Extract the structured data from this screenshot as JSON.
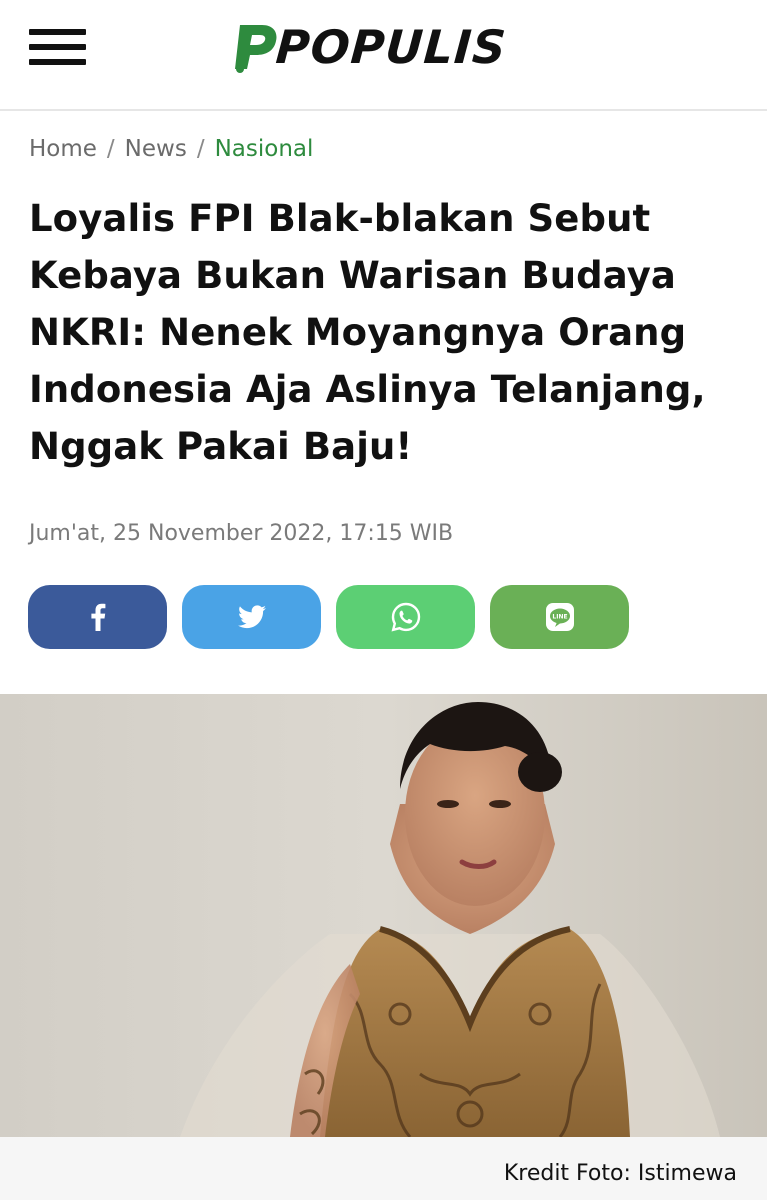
{
  "header": {
    "logo_text": "POPULIS",
    "logo_color": "#2e8b3e"
  },
  "breadcrumb": {
    "items": [
      "Home",
      "News",
      "Nasional"
    ],
    "separator": "/"
  },
  "article": {
    "title": "Loyalis FPI Blak-blakan Sebut Kebaya Bukan Warisan Budaya NKRI: Nenek Moyangnya Orang Indonesia Aja Aslinya Telanjang, Nggak Pakai Baju!",
    "date": "Jum'at, 25 November 2022, 17:15 WIB",
    "image_credit": "Kredit Foto: Istimewa"
  },
  "share": {
    "buttons": [
      {
        "icon": "facebook-icon",
        "color": "#3b5a9a"
      },
      {
        "icon": "twitter-icon",
        "color": "#4aa3e6"
      },
      {
        "icon": "whatsapp-icon",
        "color": "#5ccf74"
      },
      {
        "icon": "line-icon",
        "color": "#6ab056"
      }
    ]
  }
}
